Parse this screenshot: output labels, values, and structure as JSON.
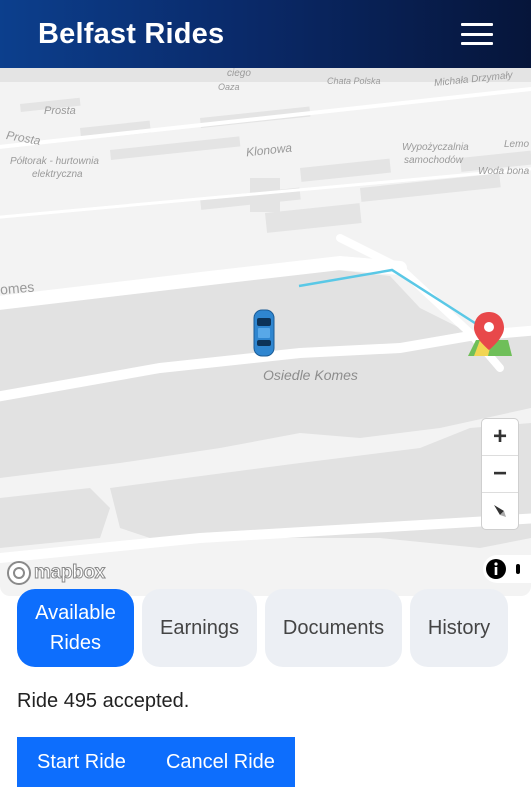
{
  "header": {
    "title": "Belfast Rides",
    "menu_icon": "hamburger-menu-icon"
  },
  "map": {
    "labels": [
      "Prosta",
      "Prosta",
      "Półtorak - hurtownia",
      "elektryczna",
      "Klonowa",
      "Chata Polska",
      "Michała Drzymały",
      "Wypożyczalnia",
      "samochodów",
      "Lemo",
      "Woda bona",
      "Oaza",
      "ciego",
      "omes",
      "Osiedle Komes"
    ],
    "zoom_in_label": "+",
    "zoom_out_label": "−",
    "attribution_logo": "mapbox",
    "route_color": "#5ac8e6",
    "car_color": "#2f86d0",
    "destination_pin_color": "#e8484a"
  },
  "tabs": [
    {
      "label_line1": "Available",
      "label_line2": "Rides",
      "active": true
    },
    {
      "label": "Earnings",
      "active": false
    },
    {
      "label": "Documents",
      "active": false
    },
    {
      "label": "History",
      "active": false
    }
  ],
  "status_text": "Ride 495 accepted.",
  "actions": {
    "start_label": "Start Ride",
    "cancel_label": "Cancel Ride"
  },
  "colors": {
    "primary": "#0d6efd",
    "header_start": "#0c3f8d",
    "header_end": "#06153a"
  }
}
